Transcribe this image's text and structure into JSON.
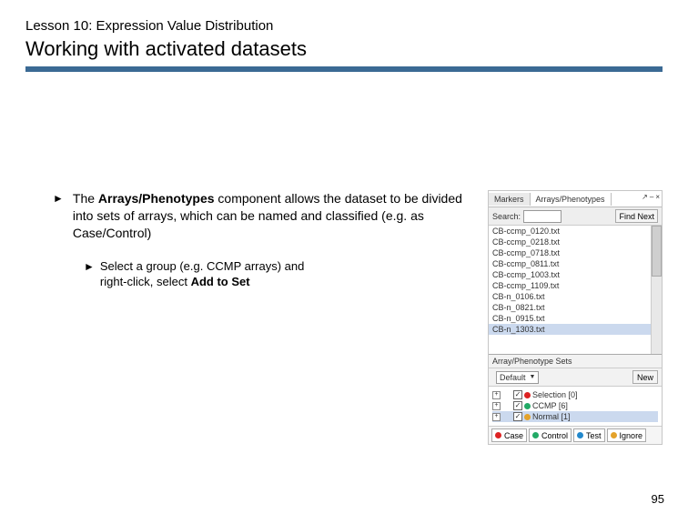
{
  "header": {
    "lesson": "Lesson 10: Expression Value Distribution",
    "title": "Working with activated datasets"
  },
  "body": {
    "para1_prefix": "The ",
    "para1_bold": "Arrays/Phenotypes",
    "para1_rest": " component allows the dataset to be divided into sets of arrays, which can be named and classified (e.g. as Case/Control)",
    "para2_prefix": "Select a group (e.g. CCMP arrays) and right-click, select ",
    "para2_bold": "Add to Set"
  },
  "panel": {
    "tab1": "Markers",
    "tab2": "Arrays/Phenotypes",
    "searchLabel": "Search:",
    "findBtn": "Find Next",
    "files": [
      "CB-ccmp_0120.txt",
      "CB-ccmp_0218.txt",
      "CB-ccmp_0718.txt",
      "CB-ccmp_0811.txt",
      "CB-ccmp_1003.txt",
      "CB-ccmp_1109.txt",
      "CB-n_0106.txt",
      "CB-n_0821.txt",
      "CB-n_0915.txt",
      "CB-n_1303.txt"
    ],
    "setsHeader": "Array/Phenotype Sets",
    "setsCombo": "Default",
    "newBtn": "New",
    "tree": [
      {
        "expand": "+",
        "checked": true,
        "label": "Selection [0]",
        "color": "#d22"
      },
      {
        "expand": "+",
        "checked": true,
        "label": "CCMP [6]",
        "color": "#2a6"
      },
      {
        "expand": "+",
        "checked": true,
        "label": "Normal [1]",
        "color": "#e4a22a",
        "sel": true
      }
    ],
    "cats": [
      {
        "label": "Case",
        "color": "#d22"
      },
      {
        "label": "Control",
        "color": "#2a6"
      },
      {
        "label": "Test",
        "color": "#28c"
      },
      {
        "label": "Ignore",
        "color": "#e4a22a"
      }
    ]
  },
  "pageNum": "95"
}
